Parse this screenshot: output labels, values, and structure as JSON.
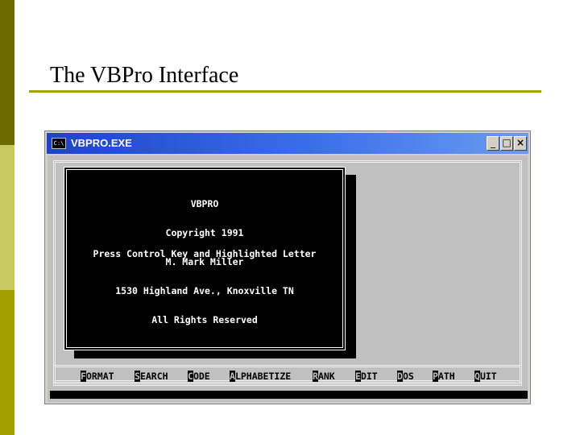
{
  "slide": {
    "title": "The VBPro Interface"
  },
  "window": {
    "title": "VBPRO.EXE",
    "icon_text": "C:\\",
    "minimize_label": "_",
    "maximize_label": "□",
    "close_label": "×"
  },
  "dialog": {
    "lines": [
      "VBPRO",
      "Copyright 1991",
      "M. Mark Miller",
      "1530 Highland Ave., Knoxville TN",
      "All Rights Reserved"
    ],
    "hint": "Press Control Key and Highlighted Letter"
  },
  "menu": [
    {
      "hotkey": "F",
      "rest": "ORMAT"
    },
    {
      "hotkey": "S",
      "rest": "EARCH"
    },
    {
      "hotkey": "C",
      "rest": "ODE"
    },
    {
      "hotkey": "A",
      "rest": "LPHABETIZE"
    },
    {
      "hotkey": "R",
      "rest": "ANK"
    },
    {
      "hotkey": "E",
      "rest": "DIT"
    },
    {
      "hotkey": "D",
      "rest": "OS"
    },
    {
      "hotkey": "P",
      "rest": "ATH"
    },
    {
      "hotkey": "Q",
      "rest": "UIT"
    }
  ],
  "colors": {
    "titlebar": "#1d44c8",
    "console_bg": "#000000",
    "console_text": "#ffffff",
    "screen_bg": "#c0c0c0",
    "accent_rule": "#a3a300"
  }
}
